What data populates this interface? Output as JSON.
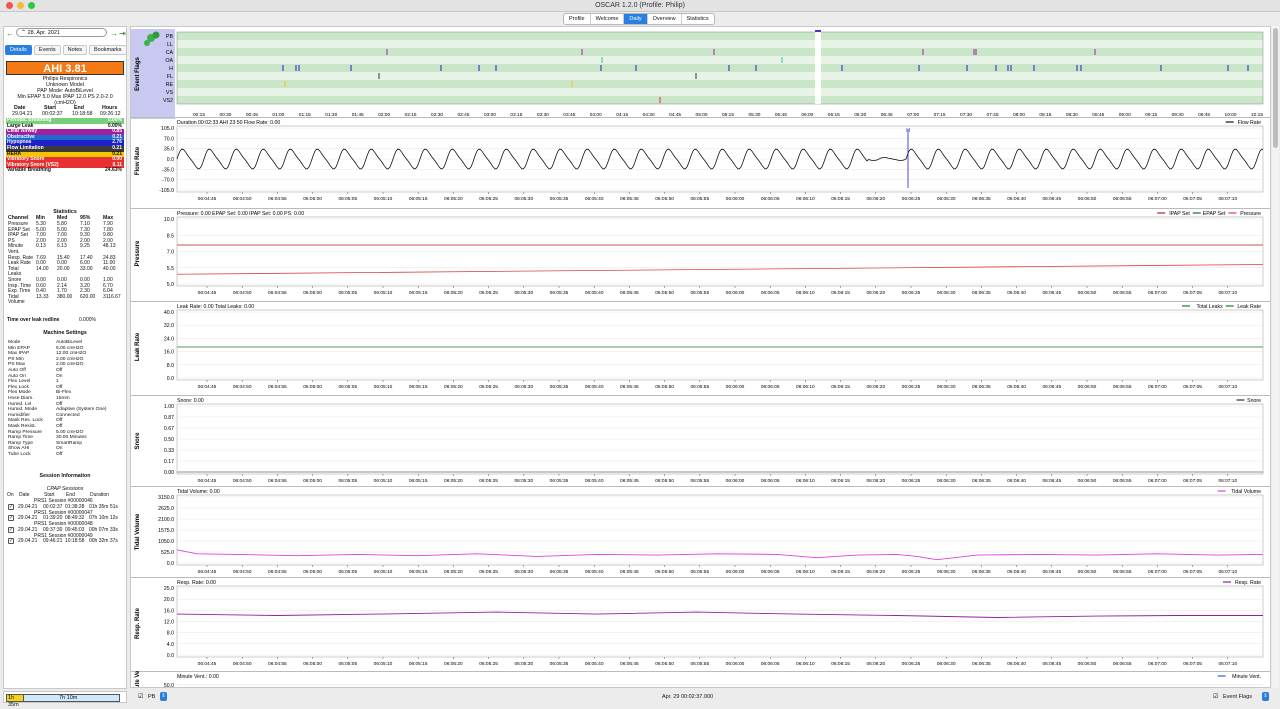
{
  "window": {
    "title": "OSCAR 1.2.0 (Profile: Philip)",
    "tabs": [
      "Profile",
      "Welcome",
      "Daily",
      "Overview",
      "Statistics"
    ],
    "active_tab": "Daily"
  },
  "left": {
    "date": "28. Apr. 2021",
    "subtabs": [
      "Details",
      "Events",
      "Notes",
      "Bookmarks"
    ],
    "ahi": "AHI 3.81",
    "machine_brand": "Philips Respironics",
    "machine_model": "Unknown Model",
    "pap_mode": "PAP Mode: AutoBiLevel",
    "pressure_summary": "Min EPAP 5.0 Max IPAP 12.0 PS 2.0-2.0 (cmH2O)",
    "session_header": [
      "Date",
      "Start",
      "End",
      "Hours"
    ],
    "session_values": [
      "29.04.21",
      "00:02:37",
      "10:18:58",
      "09:26:12"
    ],
    "events": [
      {
        "label": "Periodic Breathing",
        "value": "0.00%",
        "bg": "#7ad07a",
        "fg": "#ffffff"
      },
      {
        "label": "Large Leak",
        "value": "0.00%",
        "bg": "#ffffff",
        "fg": "#111111"
      },
      {
        "label": "Clear Airway",
        "value": "0.85",
        "bg": "#a020a0",
        "fg": "#ffffff"
      },
      {
        "label": "Obstructive",
        "value": "0.21",
        "bg": "#1e6ad0",
        "fg": "#ffffff"
      },
      {
        "label": "Hypopnea",
        "value": "2.76",
        "bg": "#2020c8",
        "fg": "#ffffff"
      },
      {
        "label": "Flow Limitation",
        "value": "0.21",
        "bg": "#3a3a3a",
        "fg": "#ffffff"
      },
      {
        "label": "RERA",
        "value": "0.21",
        "bg": "#f4c400",
        "fg": "#111111"
      },
      {
        "label": "Vibratory Snore",
        "value": "0.00",
        "bg": "#e83030",
        "fg": "#ffffff"
      },
      {
        "label": "Vibratory Snore (VS2)",
        "value": "0.11",
        "bg": "#e83030",
        "fg": "#ffffff"
      },
      {
        "label": "Variable Breathing",
        "value": "24.63%",
        "bg": "#ffffff",
        "fg": "#111111"
      }
    ],
    "statistics_title": "Statistics",
    "stats_header": [
      "Channel",
      "Min",
      "Med",
      "95%",
      "Max"
    ],
    "stats": [
      [
        "Pressure",
        "5.30",
        "5.80",
        "7.10",
        "7.90"
      ],
      [
        "EPAP Set",
        "5.00",
        "5.00",
        "7.30",
        "7.80"
      ],
      [
        "IPAP Set",
        "7.00",
        "7.00",
        "9.30",
        "9.80"
      ],
      [
        "PS",
        "2.00",
        "2.00",
        "2.00",
        "2.00"
      ],
      [
        "Minute Vent.",
        "0.13",
        "6.13",
        "9.25",
        "48.13"
      ],
      [
        "Resp. Rate",
        "7.69",
        "15.40",
        "17.40",
        "24.83"
      ],
      [
        "Leak Rate",
        "0.00",
        "0.00",
        "6.00",
        "11.00"
      ],
      [
        "Total Leaks",
        "14.00",
        "20.00",
        "33.00",
        "40.00"
      ],
      [
        "Snore",
        "0.00",
        "0.00",
        "0.00",
        "1.00"
      ],
      [
        "Insp. Time",
        "0.60",
        "2.14",
        "3.20",
        "6.70"
      ],
      [
        "Exp. Time",
        "0.40",
        "1.70",
        "2.30",
        "6.04"
      ],
      [
        "Tidal Volume",
        "13.33",
        "380.00",
        "620.00",
        "3116.67"
      ]
    ],
    "time_over_leak_label": "Time over leak redline",
    "time_over_leak_value": "0.000%",
    "machine_settings_title": "Machine Settings",
    "settings": [
      [
        "Mode",
        "AutoBiLevel"
      ],
      [
        "Min EPAP",
        "5.00 cmH2O"
      ],
      [
        "Max IPAP",
        "12.00 cmH2O"
      ],
      [
        "PS Min",
        "2.00 cmH2O"
      ],
      [
        "PS Max",
        "2.00 cmH2O"
      ],
      [
        "Auto Off",
        "Off"
      ],
      [
        "Auto On",
        "On"
      ],
      [
        "Flex Level",
        "1"
      ],
      [
        "Flex Lock",
        "Off"
      ],
      [
        "Flex Mode",
        "Bi-Flex"
      ],
      [
        "Hose Diam.",
        "15mm"
      ],
      [
        "Humid. Lvl",
        "Off"
      ],
      [
        "Humid. Mode",
        "Adaptive (System One)"
      ],
      [
        "Humidifier",
        "Connected"
      ],
      [
        "Mask Res. Lock",
        "Off"
      ],
      [
        "Mask Resist.",
        "Off"
      ],
      [
        "Ramp Pressure",
        "5.00 cmH2O"
      ],
      [
        "Ramp Time",
        "30.00 Minutes"
      ],
      [
        "Ramp Type",
        "SmartRamp"
      ],
      [
        "Show AHI",
        "On"
      ],
      [
        "Tube Lock",
        "Off"
      ]
    ],
    "session_info_title": "Session Information",
    "cpap_sessions_title": "CPAP Sessions",
    "sessions_header": [
      "On",
      "Date",
      "Start",
      "End",
      "Duration"
    ],
    "sessions": [
      {
        "label": "PRS1 Session #00000046",
        "date": "29.04.21",
        "start": "00:02:37",
        "end": "01:38:28",
        "dur": "01h 35m 51s"
      },
      {
        "label": "PRS1 Session #00000047",
        "date": "29.04.21",
        "start": "01:39:20",
        "end": "08:49:32",
        "dur": "07h 10m 12s"
      },
      {
        "label": "PRS1 Session #00000048",
        "date": "29.04.21",
        "start": "09:37:30",
        "end": "09:45:03",
        "dur": "00h 07m 33s"
      },
      {
        "label": "PRS1 Session #00000049",
        "date": "29.04.21",
        "start": "09:46:21",
        "end": "10:18:58",
        "dur": "00h 32m 37s"
      }
    ],
    "timebar_a": "1h 35m",
    "timebar_b": "7h 10m"
  },
  "flags": {
    "title": "Event Flags",
    "rows": [
      "PB",
      "LL",
      "CA",
      "OA",
      "H",
      "FL",
      "RE",
      "VS",
      "VS2"
    ],
    "time_ticks": [
      "00:15",
      "00:30",
      "00:45",
      "01:00",
      "01:15",
      "01:30",
      "01:45",
      "02:00",
      "02:15",
      "02:30",
      "02:45",
      "03:00",
      "03:15",
      "03:30",
      "03:45",
      "04:00",
      "04:15",
      "04:30",
      "04:45",
      "05:00",
      "05:15",
      "05:30",
      "05:45",
      "06:00",
      "06:15",
      "06:30",
      "06:45",
      "07:00",
      "07:15",
      "07:30",
      "07:45",
      "08:00",
      "08:15",
      "08:30",
      "08:45",
      "09:00",
      "09:15",
      "09:30",
      "09:45",
      "10:00",
      "10:15"
    ]
  },
  "time_ticks": [
    "06:04:45",
    "06:04:50",
    "06:04:55",
    "06:05:00",
    "06:05:05",
    "06:05:10",
    "06:05:15",
    "06:05:20",
    "06:05:25",
    "06:05:30",
    "06:05:35",
    "06:05:40",
    "06:05:45",
    "06:05:50",
    "06:05:55",
    "06:06:00",
    "06:06:05",
    "06:06:10",
    "06:06:15",
    "06:06:20",
    "06:06:25",
    "06:06:30",
    "06:06:35",
    "06:06:40",
    "06:06:45",
    "06:06:50",
    "06:06:55",
    "06:07:00",
    "06:07:05",
    "06:07:10"
  ],
  "charts": [
    {
      "name": "Flow Rate",
      "header": "Duration 00:02:33 AHI 23:50 Flow Rate: 0.00",
      "legend": [
        "Flow Rate"
      ],
      "legend_colors": [
        "#111111"
      ],
      "ticks": [
        "105.0",
        "70.0",
        "35.0",
        "0.0",
        "-35.0",
        "-70.0",
        "-105.0"
      ]
    },
    {
      "name": "Pressure",
      "header": "Pressure: 0.00 EPAP Set: 0.00 IPAP Set: 0.00 PS: 0.00",
      "legend": [
        "IPAP Set",
        "EPAP Set",
        "Pressure"
      ],
      "legend_colors": [
        "#b02020",
        "#1a6a2a",
        "#e04040"
      ],
      "ticks": [
        "10.0",
        "8.5",
        "7.0",
        "5.5",
        "5.0"
      ]
    },
    {
      "name": "Leak Rate",
      "header": "Leak Rate: 0.00 Total Leaks: 0.00",
      "legend": [
        "Total Leaks",
        "Leak Rate"
      ],
      "legend_colors": [
        "#1a7a2a",
        "#1a7a2a"
      ],
      "ticks": [
        "40.0",
        "32.0",
        "24.0",
        "16.0",
        "8.0",
        "0.0"
      ]
    },
    {
      "name": "Snore",
      "header": "Snore: 0.00",
      "legend": [
        "Snore"
      ],
      "legend_colors": [
        "#333333"
      ],
      "ticks": [
        "1.00",
        "0.87",
        "0.67",
        "0.50",
        "0.33",
        "0.17",
        "0.00"
      ]
    },
    {
      "name": "Tidal Volume",
      "header": "Tidal Volume: 0.00",
      "legend": [
        "Tidal Volume"
      ],
      "legend_colors": [
        "#e040e0"
      ],
      "ticks": [
        "3150.0",
        "2625.0",
        "2100.0",
        "1575.0",
        "1050.0",
        "525.0",
        "0.0"
      ]
    },
    {
      "name": "Resp. Rate",
      "header": "Resp. Rate: 0.00",
      "legend": [
        "Resp. Rate"
      ],
      "legend_colors": [
        "#9020a0"
      ],
      "ticks": [
        "25.0",
        "20.0",
        "16.0",
        "12.0",
        "8.0",
        "4.0",
        "0.0"
      ]
    },
    {
      "name": "Minute Vent.",
      "header": "Minute Vent.: 0.00",
      "legend": [
        "Minute Vent."
      ],
      "legend_colors": [
        "#1e6ad0"
      ],
      "ticks": [
        "50.0"
      ]
    }
  ],
  "bottom": {
    "pb_label": "PB",
    "timestamp": "Apr. 29 00:02:37.000",
    "event_flags_label": "Event Flags"
  },
  "colors": {
    "accent": "#2a7de1",
    "ahi_bg": "#f47a16",
    "flag_row_green": "#c8e6c8",
    "flag_panel": "#c8c8f0"
  }
}
